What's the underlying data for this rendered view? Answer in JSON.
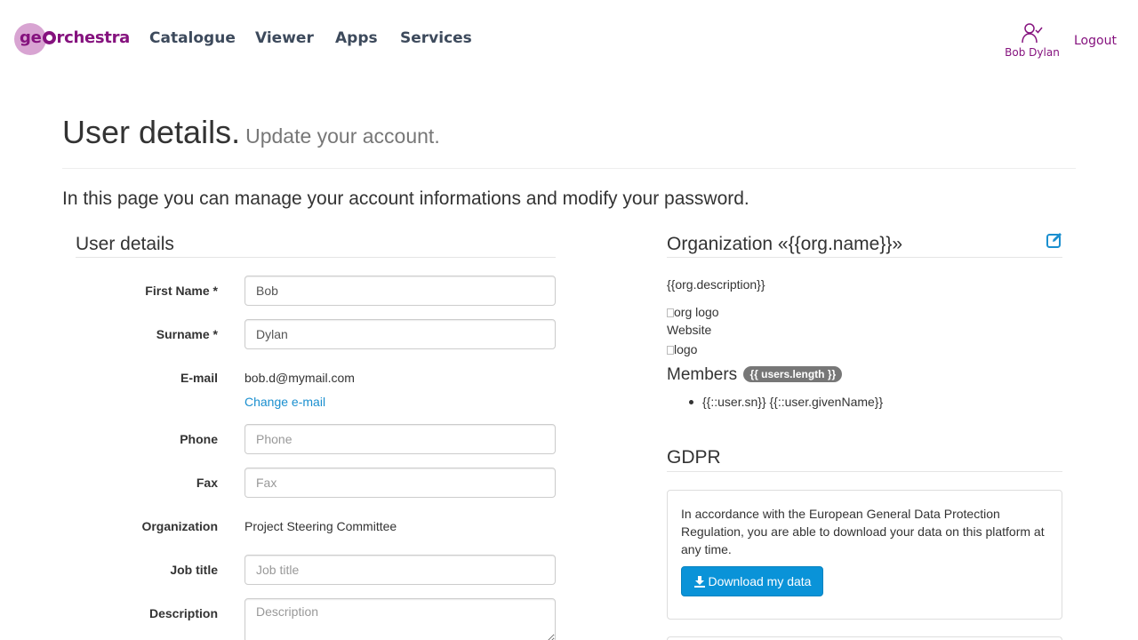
{
  "header": {
    "logo_text_pre": "ge",
    "logo_text_post": "rchestra",
    "nav": [
      "Catalogue",
      "Viewer",
      "Apps",
      "Services"
    ],
    "user_name": "Bob Dylan",
    "logout_label": "Logout",
    "brand_color": "#85127e"
  },
  "page": {
    "title": "User details.",
    "subtitle": "Update your account.",
    "lead": "In this page you can manage your account informations and modify your password."
  },
  "user_details": {
    "heading": "User details",
    "first_name_label": "First Name *",
    "first_name_value": "Bob",
    "surname_label": "Surname *",
    "surname_value": "Dylan",
    "email_label": "E-mail",
    "email_value": "bob.d@mymail.com",
    "change_email_label": "Change e-mail",
    "phone_label": "Phone",
    "phone_placeholder": "Phone",
    "fax_label": "Fax",
    "fax_placeholder": "Fax",
    "organization_label": "Organization",
    "organization_value": "Project Steering Committee",
    "job_title_label": "Job title",
    "job_title_placeholder": "Job title",
    "description_label": "Description",
    "description_placeholder": "Description"
  },
  "organization": {
    "heading": "Organization «{{org.name}}»",
    "description": "{{org.description}}",
    "org_logo_alt": "org logo",
    "website_label": "Website",
    "logo_alt": "logo",
    "members_label": "Members",
    "members_badge": "{{ users.length }}",
    "member_item": "{{::user.sn}} {{::user.givenName}}",
    "link_color": "#1a8fcf"
  },
  "gdpr": {
    "heading": "GDPR",
    "text": "In accordance with the European General Data Protection Regulation, you are able to download your data on this platform at any time.",
    "download_label": "Download my data",
    "button_color": "#0a93d8"
  }
}
